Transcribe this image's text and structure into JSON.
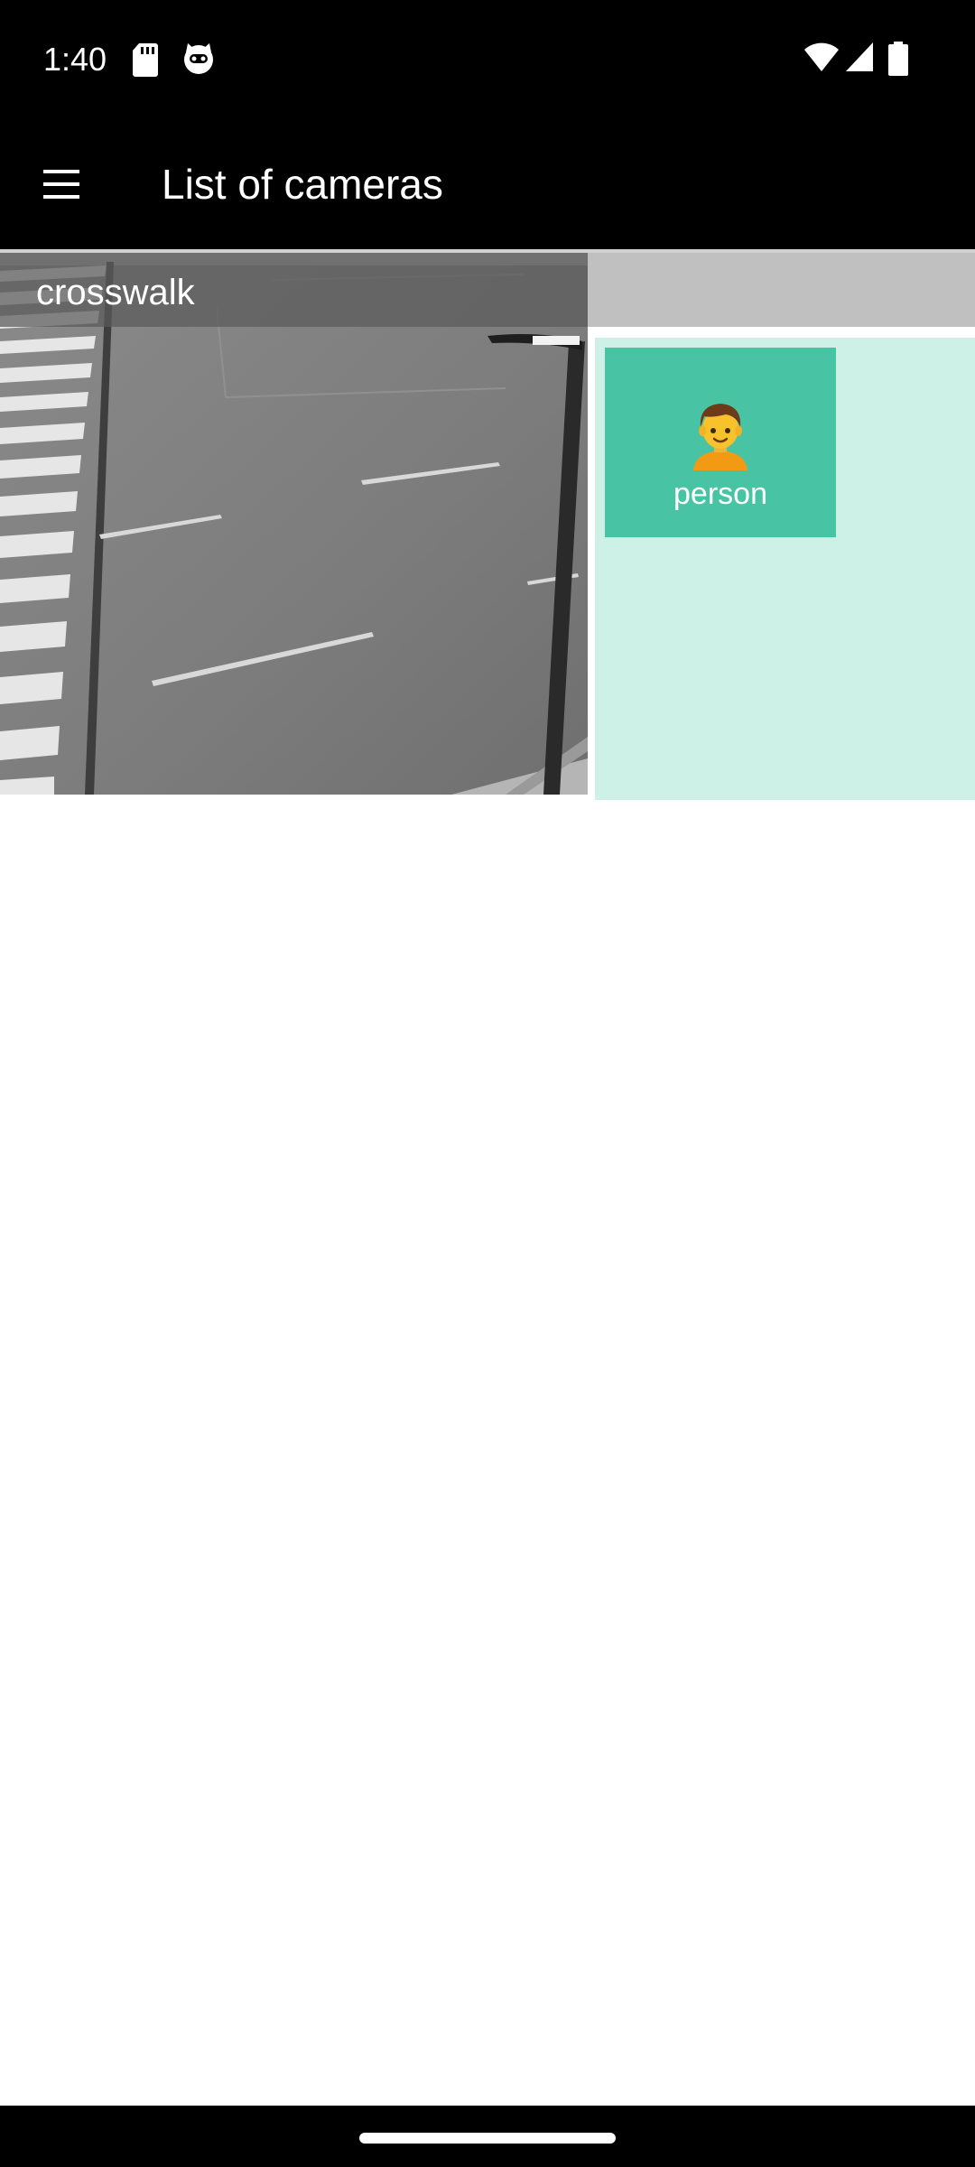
{
  "status_bar": {
    "time": "1:40",
    "left_icons": [
      "sd-card-icon",
      "cat-face-icon"
    ],
    "right_icons": [
      "wifi-icon",
      "cell-signal-icon",
      "battery-icon"
    ]
  },
  "app_bar": {
    "menu_icon": "hamburger-menu-icon",
    "title": "List of cameras"
  },
  "cameras": [
    {
      "name": "crosswalk",
      "detections": [
        {
          "emoji": "person-icon",
          "label": "person"
        }
      ]
    }
  ],
  "colors": {
    "bars": "#000000",
    "detection_tile": "#48c4a5",
    "detection_panel": "#cdf1e6",
    "name_strip_right": "#c0c0c0"
  }
}
